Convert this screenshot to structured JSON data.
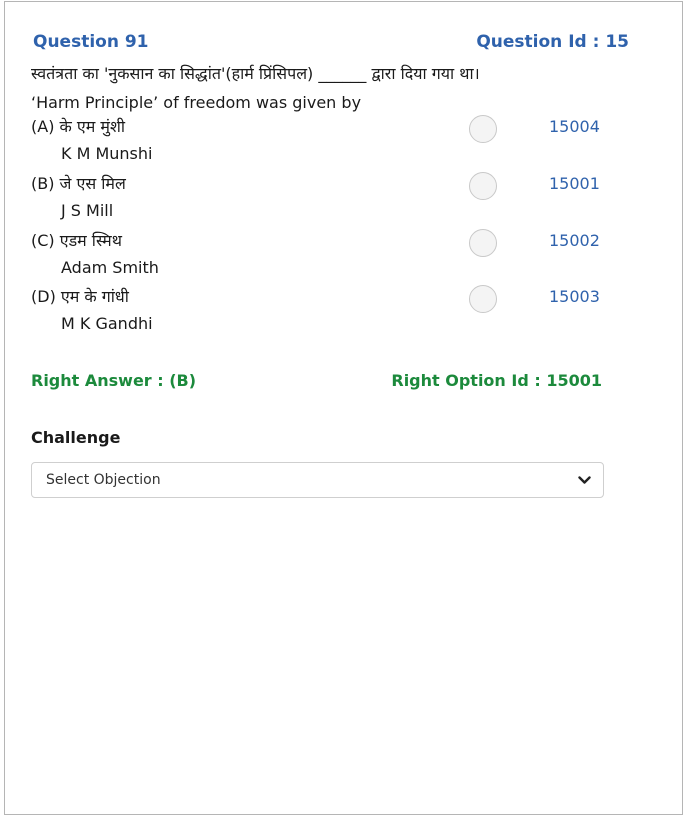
{
  "question": {
    "number_label": "Question 91",
    "id_label": "Question Id : 15",
    "text_hindi": "स्वतंत्रता का 'नुकसान का सिद्धांत'(हार्म प्रिंसिपल) ______ द्वारा दिया गया था।",
    "text_english": "‘Harm Principle’ of freedom was given by"
  },
  "options": [
    {
      "hindi": "(A) के एम मुंशी",
      "english": "K M Munshi",
      "option_id": "15004"
    },
    {
      "hindi": "(B) जे एस मिल",
      "english": "J S Mill",
      "option_id": "15001"
    },
    {
      "hindi": "(C) एडम स्मिथ",
      "english": "Adam Smith",
      "option_id": "15002"
    },
    {
      "hindi": "(D) एम के गांधी",
      "english": "M K Gandhi",
      "option_id": "15003"
    }
  ],
  "answer": {
    "right_answer": "Right Answer : (B)",
    "right_option_id": "Right Option Id : 15001"
  },
  "challenge": {
    "label": "Challenge",
    "select_value": "Select Objection",
    "icon": "chevron-down-icon"
  },
  "colors": {
    "heading_blue": "#2f62ac",
    "answer_green": "#1c8a3c"
  }
}
